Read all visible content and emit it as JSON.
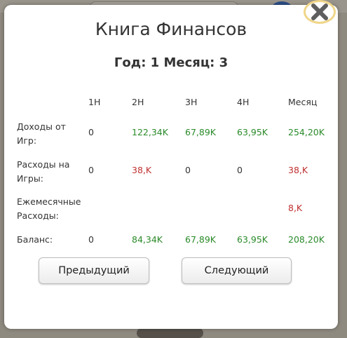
{
  "dialog": {
    "title": "Книга Финансов",
    "subtitle": "Год: 1 Месяц: 3"
  },
  "table": {
    "headers": [
      "1Н",
      "2Н",
      "3Н",
      "4Н",
      "Месяц"
    ],
    "rows": [
      {
        "label_lines": [
          "Доходы от",
          "Игр:"
        ],
        "values": [
          "0",
          "122,34K",
          "67,89K",
          "63,95K",
          "254,20K"
        ]
      },
      {
        "label_lines": [
          "Расходы на",
          "Игры:"
        ],
        "values": [
          "0",
          "38,K",
          "0",
          "0",
          "38,K"
        ]
      },
      {
        "label_lines": [
          "Ежемесячные",
          "Расходы:"
        ],
        "values": [
          "",
          "",
          "",
          "",
          "8,K"
        ]
      },
      {
        "label_lines": [
          "Баланс:"
        ],
        "values": [
          "0",
          "84,34K",
          "67,89K",
          "63,95K",
          "208,20K"
        ]
      }
    ]
  },
  "buttons": {
    "previous": "Предыдущий",
    "next": "Следующий"
  },
  "icons": {
    "close": "close-x-icon"
  },
  "colors": {
    "positive": "#2a8a2a",
    "negative": "#c03030",
    "close_ring": "#f0d68a"
  }
}
